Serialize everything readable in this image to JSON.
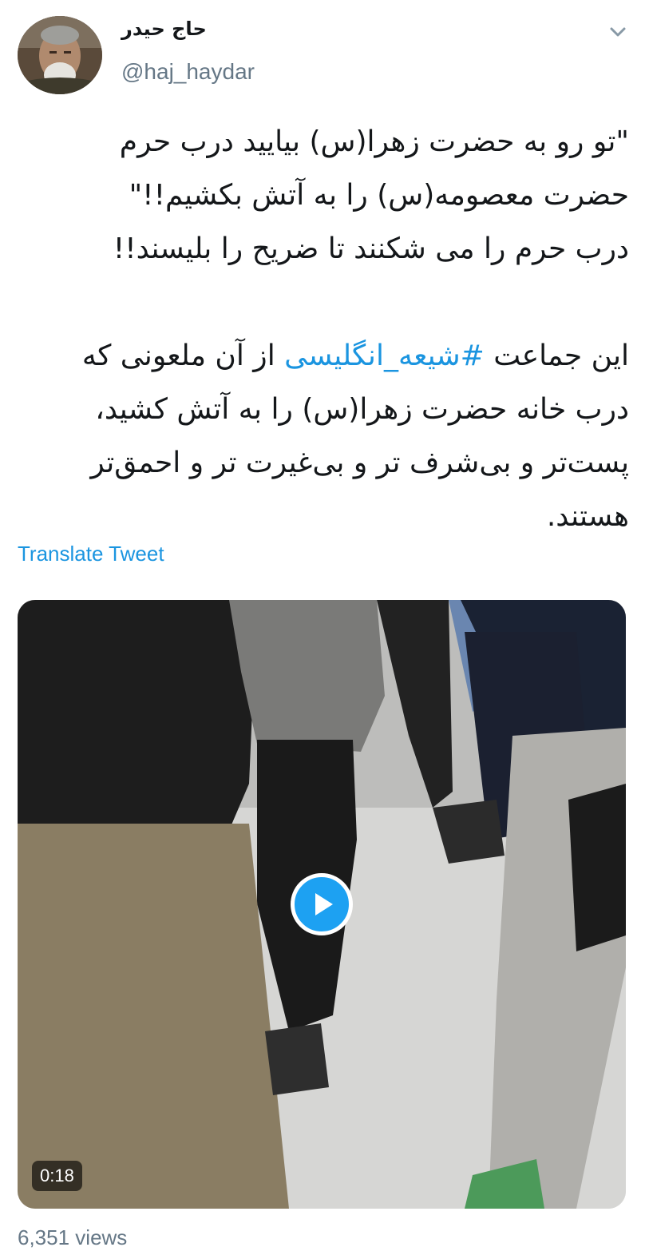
{
  "user": {
    "display_name": "حاج حیدر",
    "handle": "@haj_haydar",
    "avatar_icon": "user-avatar-photo"
  },
  "menu": {
    "icon": "chevron-down-icon"
  },
  "tweet": {
    "lines": {
      "l1": "\"تو رو به حضرت زهرا(س) بیایید درب حرم",
      "l2": "حضرت معصومه(س) را به آتش بکشیم!!\"",
      "l3": "درب حرم را می شکنند تا ضریح را بلیسند!!",
      "l4_before": "این جماعت ",
      "l4_hashtag": "#شیعه_انگلیسی",
      "l4_after": " از آن ملعونی که",
      "l5": "درب خانه حضرت زهرا(س) را به آتش کشید،",
      "l6": "پست‌تر و بی‌شرف تر و بی‌غیرت تر و احمق‌تر",
      "l7": "هستند."
    },
    "hashtag_color": "#1b95e0"
  },
  "translate": {
    "label": "Translate Tweet"
  },
  "video": {
    "duration": "0:18",
    "play_icon": "play-icon",
    "accent": "#1da1f2"
  },
  "stats": {
    "views": "6,351 views"
  }
}
